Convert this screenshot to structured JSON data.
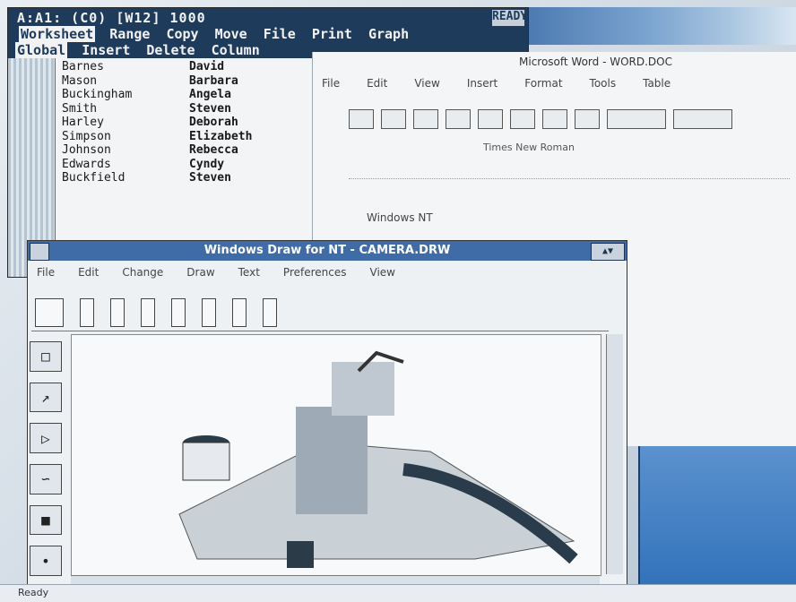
{
  "lotus": {
    "cell_ref": "A:A1: (C0) [W12] 1000",
    "mode": "READY",
    "menu_row1": [
      "Worksheet",
      "Range",
      "Copy",
      "Move",
      "File",
      "Print",
      "Graph"
    ],
    "menu_row2": [
      "Global",
      "Insert",
      "Delete",
      "Column"
    ],
    "rows": [
      {
        "last": "Barnes",
        "first": "David"
      },
      {
        "last": "Mason",
        "first": "Barbara"
      },
      {
        "last": "Buckingham",
        "first": "Angela"
      },
      {
        "last": "Smith",
        "first": "Steven"
      },
      {
        "last": "Harley",
        "first": "Deborah"
      },
      {
        "last": "Simpson",
        "first": "Elizabeth"
      },
      {
        "last": "Johnson",
        "first": "Rebecca"
      },
      {
        "last": "Edwards",
        "first": "Cyndy"
      },
      {
        "last": "Buckfield",
        "first": "Steven"
      }
    ]
  },
  "word": {
    "title": "Microsoft Word - WORD.DOC",
    "menu": [
      "File",
      "Edit",
      "View",
      "Insert",
      "Format",
      "Tools",
      "Table"
    ],
    "fmt_text": "Times New Roman",
    "body_text": "Windows NT"
  },
  "draw": {
    "title": "Windows Draw for NT - CAMERA.DRW",
    "menu": [
      "File",
      "Edit",
      "Change",
      "Draw",
      "Text",
      "Preferences",
      "View"
    ],
    "minmax": "▲▼"
  },
  "status": {
    "text": "Ready"
  }
}
